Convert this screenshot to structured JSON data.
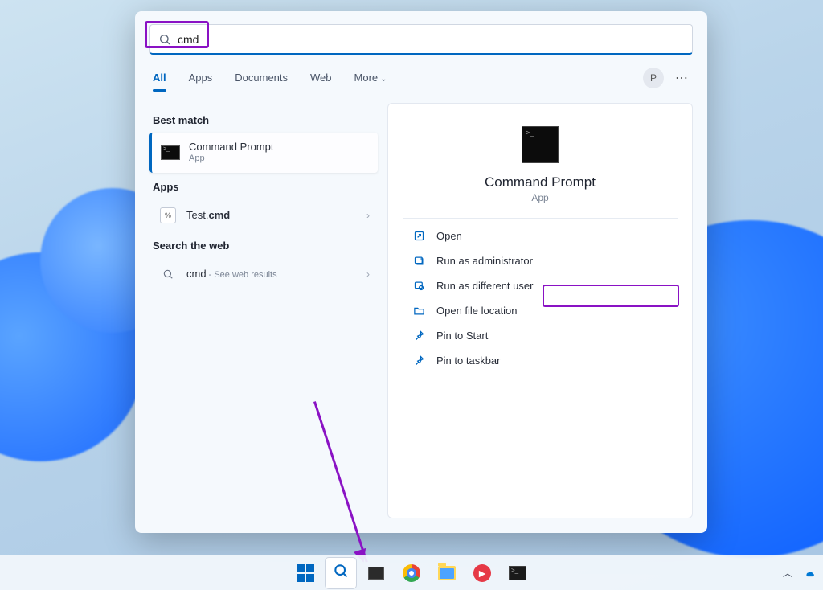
{
  "search": {
    "query": "cmd"
  },
  "tabs": {
    "items": [
      "All",
      "Apps",
      "Documents",
      "Web",
      "More"
    ],
    "active_index": 0,
    "avatar_initial": "P"
  },
  "left": {
    "best_header": "Best match",
    "best": {
      "title": "Command Prompt",
      "subtitle": "App"
    },
    "apps_header": "Apps",
    "apps": [
      {
        "prefix": "Test.",
        "bold": "cmd"
      }
    ],
    "web_header": "Search the web",
    "web": {
      "query": "cmd",
      "suffix": " - See web results"
    }
  },
  "preview": {
    "title": "Command Prompt",
    "subtitle": "App",
    "actions": [
      {
        "id": "open",
        "label": "Open"
      },
      {
        "id": "run-admin",
        "label": "Run as administrator"
      },
      {
        "id": "run-diff-user",
        "label": "Run as different user"
      },
      {
        "id": "open-location",
        "label": "Open file location"
      },
      {
        "id": "pin-start",
        "label": "Pin to Start"
      },
      {
        "id": "pin-taskbar",
        "label": "Pin to taskbar"
      }
    ]
  },
  "annotations": {
    "highlight_search": true,
    "highlight_run_admin": true,
    "arrow_to_taskbar_search": true
  },
  "taskbar": {
    "items": [
      "start",
      "search",
      "taskview",
      "chrome",
      "explorer",
      "redapp",
      "terminal"
    ],
    "active": "search"
  }
}
